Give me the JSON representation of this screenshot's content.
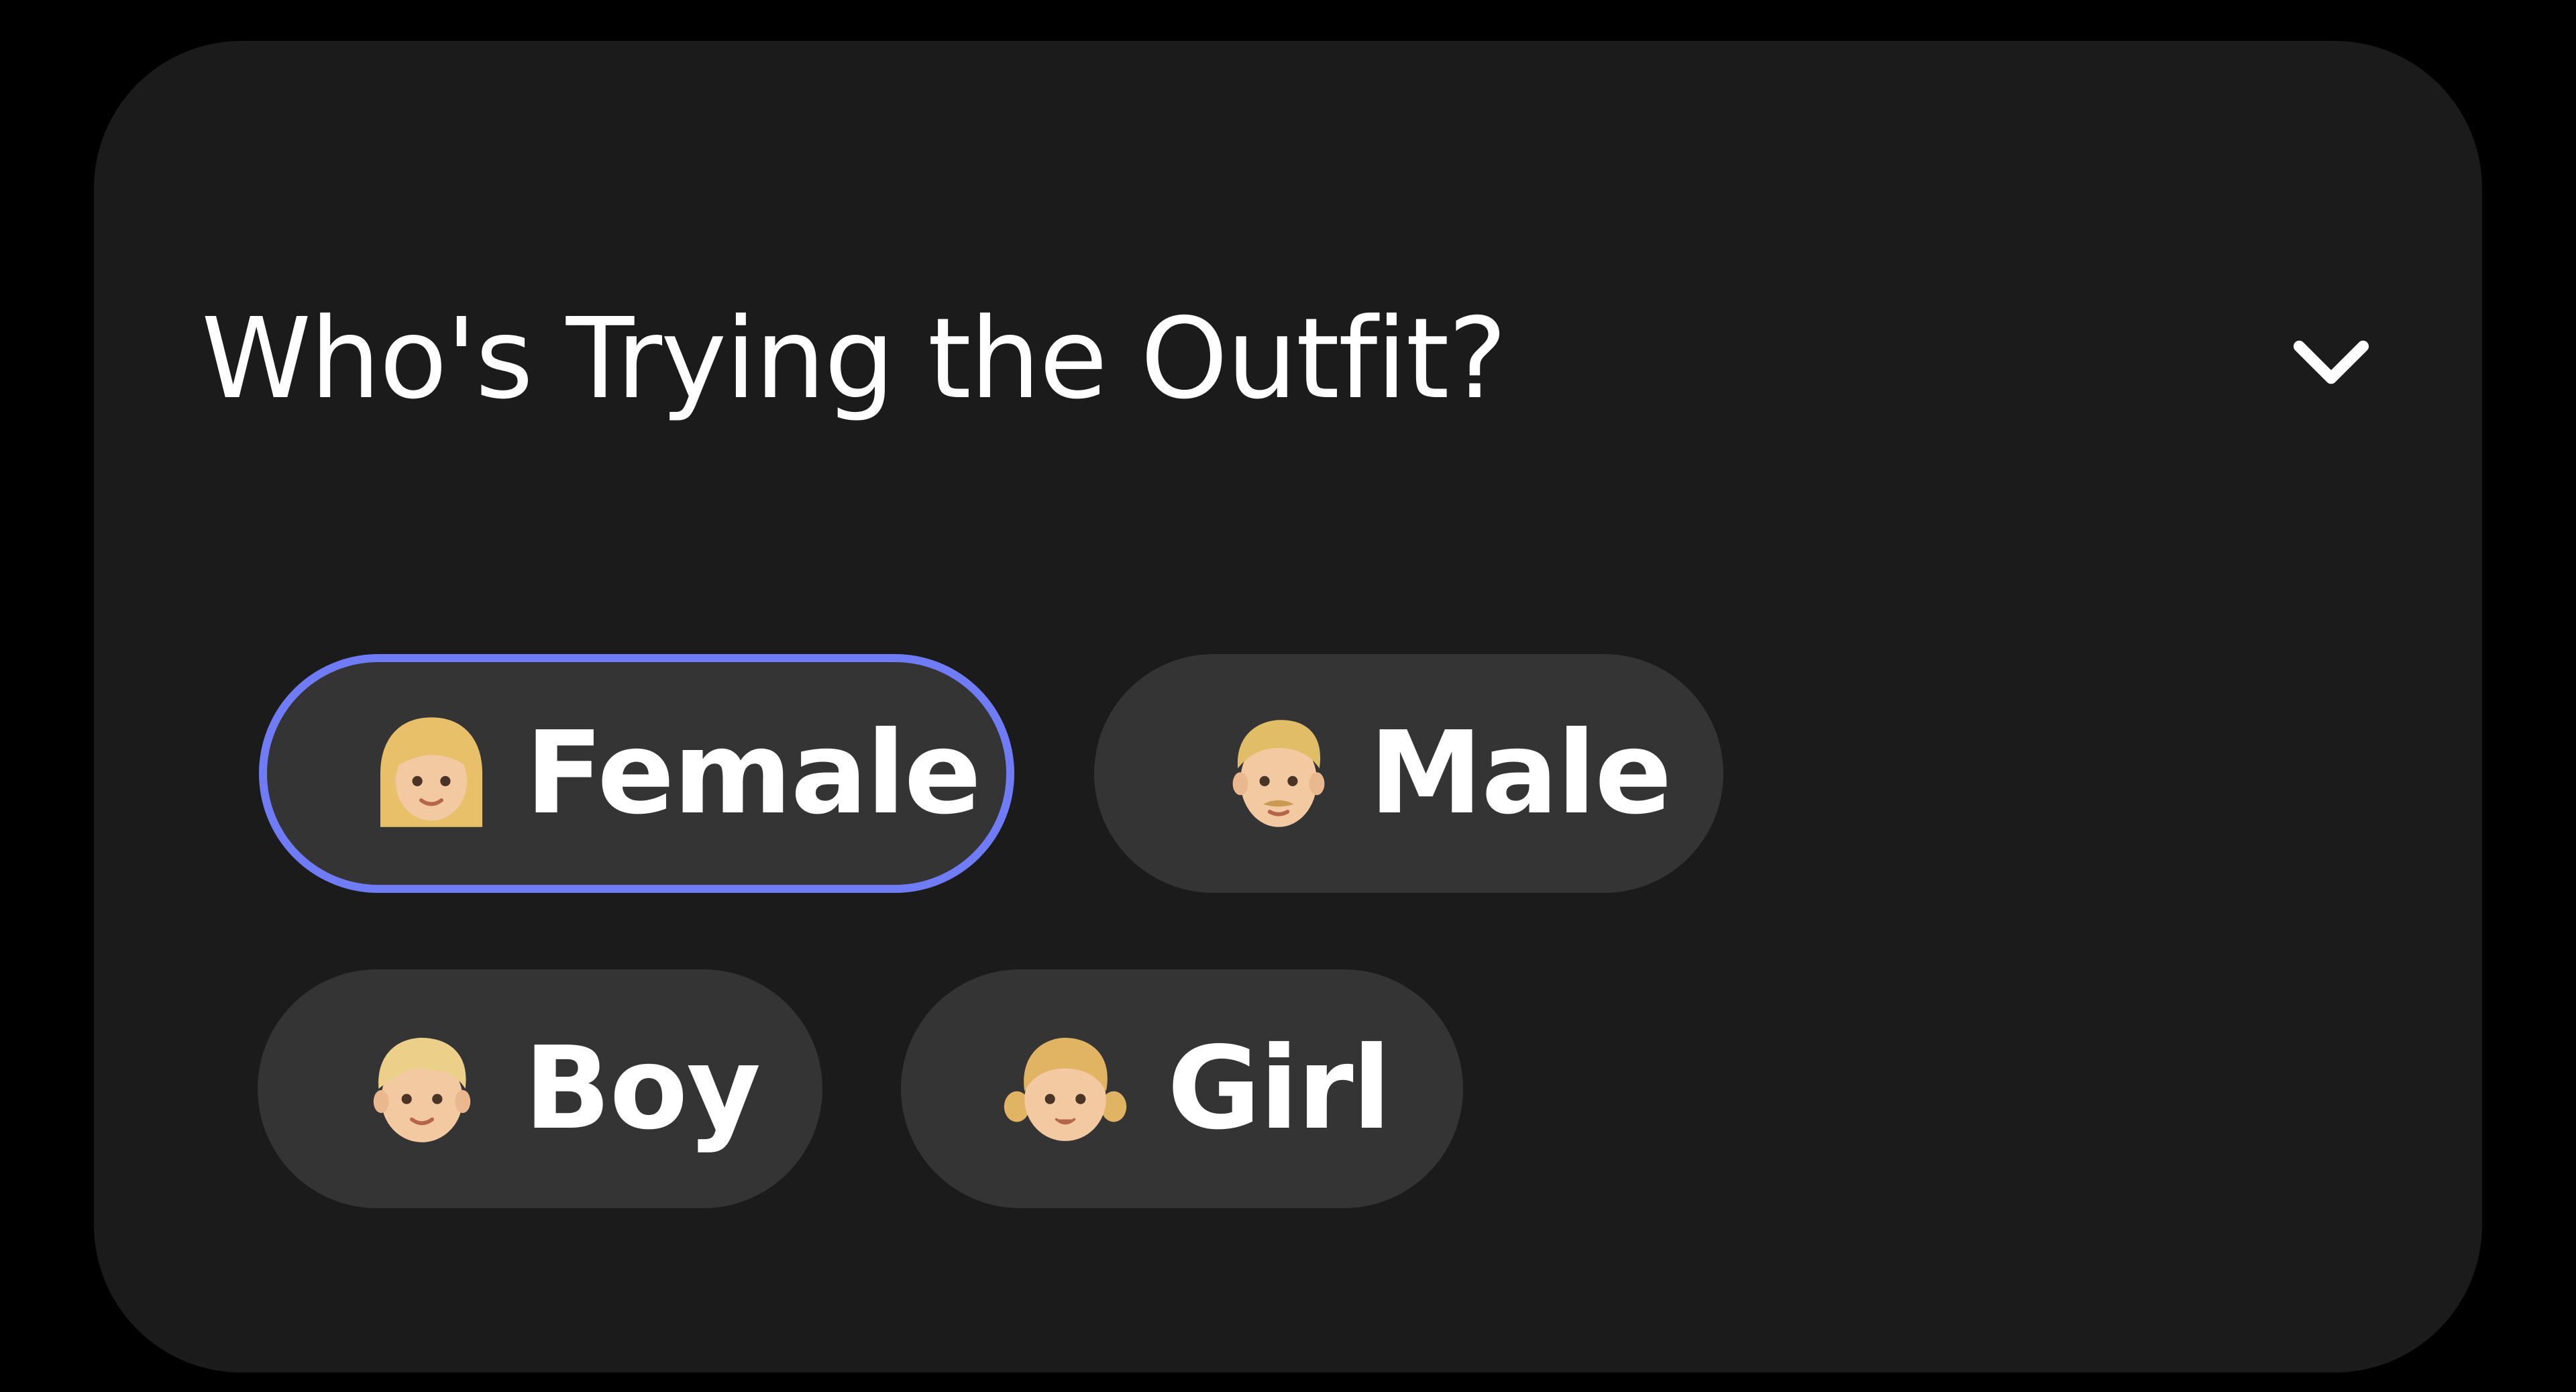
{
  "card": {
    "title": "Who's Trying the Outfit?",
    "toggle_icon": "chevron-down-icon"
  },
  "options": [
    {
      "label": "Female",
      "icon": "woman-emoji-icon",
      "selected": true
    },
    {
      "label": "Male",
      "icon": "man-emoji-icon",
      "selected": false
    },
    {
      "label": "Boy",
      "icon": "boy-emoji-icon",
      "selected": false
    },
    {
      "label": "Girl",
      "icon": "girl-emoji-icon",
      "selected": false
    }
  ],
  "colors": {
    "page_background": "#000000",
    "card_background": "#1b1b1b",
    "chip_background": "#343434",
    "selected_border": "#6f7cf5",
    "text": "#ffffff"
  }
}
